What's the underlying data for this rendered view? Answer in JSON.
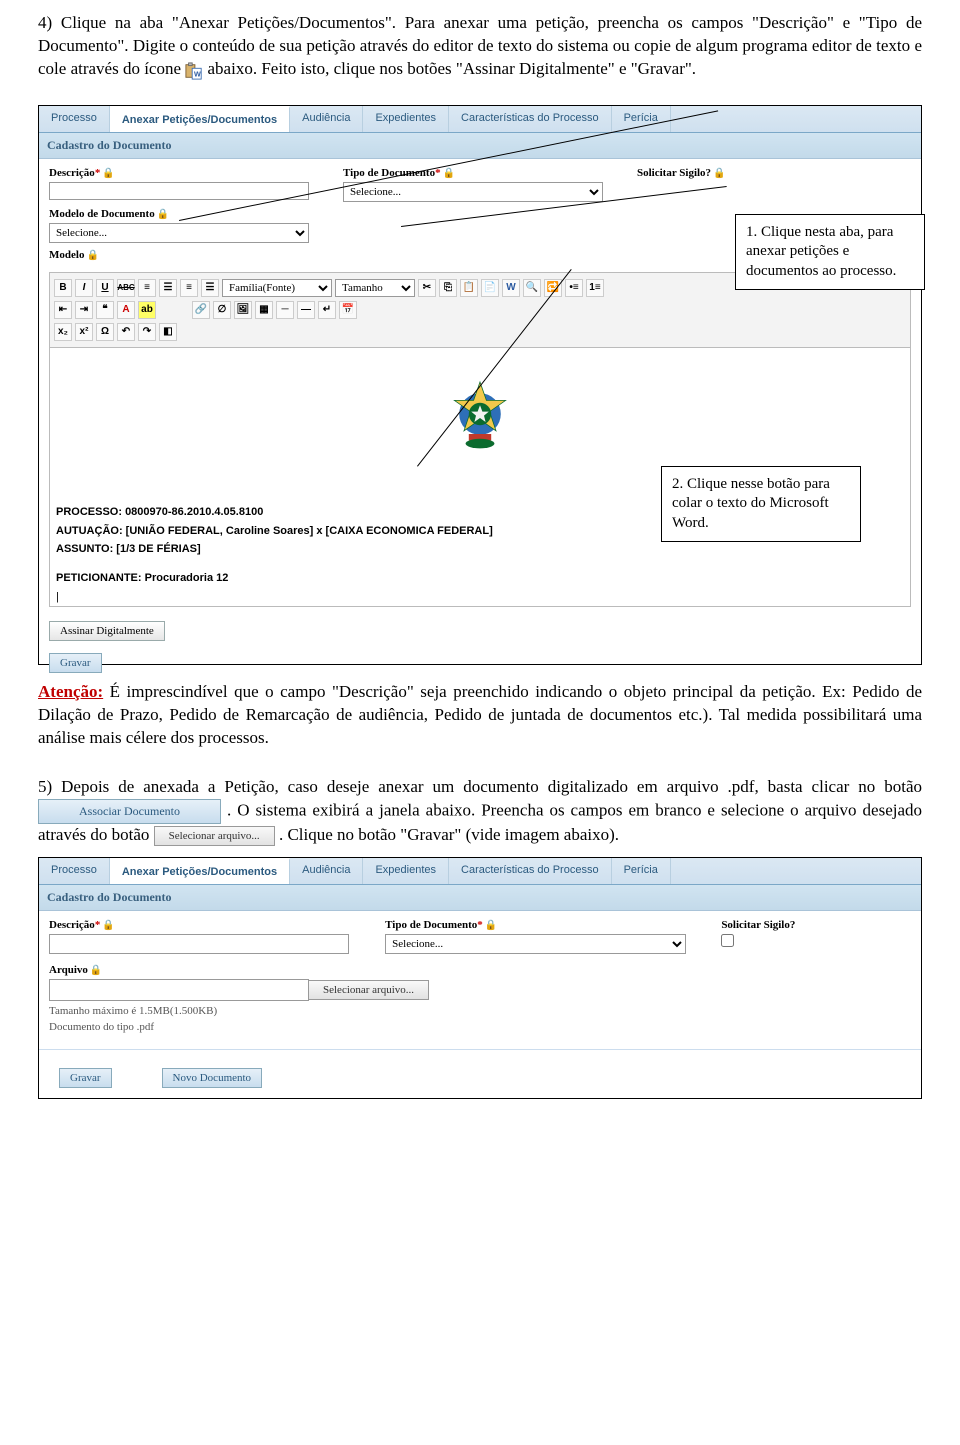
{
  "para1_a": "4) Clique na aba \"Anexar Petições/Documentos\". Para anexar uma petição, preencha os campos \"Descrição\" e \"Tipo de Documento\". Digite o conteúdo de sua petição através do editor de texto do sistema ou copie de algum programa editor de texto e cole através do ícone ",
  "para1_b": " abaixo. Feito isto, clique nos botões \"Assinar Digitalmente\" e \"Gravar\".",
  "tabs": {
    "processo": "Processo",
    "anexar": "Anexar Petições/Documentos",
    "audiencia": "Audiência",
    "expedientes": "Expedientes",
    "caracteristicas": "Características do Processo",
    "pericia": "Perícia"
  },
  "panel_title": "Cadastro do Documento",
  "labels": {
    "descricao": "Descrição",
    "tipo_doc": "Tipo de Documento",
    "solicitar_sigilo": "Solicitar Sigilo?",
    "modelo_doc": "Modelo de Documento",
    "modelo": "Modelo",
    "arquivo": "Arquivo"
  },
  "selecione": "Selecione...",
  "toolbar": {
    "bold": "B",
    "italic": "I",
    "underline": "U",
    "strike": "AB",
    "font_label": "Família(Fonte)",
    "size_label": "Tamanho"
  },
  "editor_content": {
    "processo": "PROCESSO: 0800970-86.2010.4.05.8100",
    "autuacao": "AUTUAÇÃO: [UNIÃO FEDERAL, Caroline Soares] x [CAIXA ECONOMICA FEDERAL]",
    "assunto": "ASSUNTO: [1/3 DE FÉRIAS]",
    "peticionante": "PETICIONANTE: Procuradoria 12"
  },
  "btn_assinar": "Assinar Digitalmente",
  "btn_gravar": "Gravar",
  "callout1": "1. Clique nesta aba, para anexar petições e documentos ao processo.",
  "callout2": "2. Clique nesse botão para colar o texto do Microsoft Word.",
  "atencao_label": "Atenção:",
  "atencao_text": " É imprescindível que o campo \"Descrição\" seja preenchido indicando o objeto principal da petição. Ex: Pedido de Dilação de Prazo, Pedido de Remarcação de audiência, Pedido de juntada de documentos etc.). Tal medida possibilitará uma análise mais célere dos processos.",
  "para5_a": "5) Depois de anexada a Petição, caso deseje anexar um documento digitalizado em arquivo .pdf, basta clicar no botão ",
  "assoc_btn": "Associar Documento",
  "para5_b": ". O sistema exibirá a janela abaixo. Preencha os campos em branco e selecione o arquivo desejado através do botão ",
  "sel_arq_btn": "Selecionar arquivo...",
  "para5_c": ". Clique no botão \"Gravar\" (vide imagem abaixo).",
  "hint_tamanho": "Tamanho máximo é 1.5MB(1.500KB)",
  "hint_tipo": "Documento do tipo .pdf",
  "btn_novo_doc": "Novo Documento"
}
